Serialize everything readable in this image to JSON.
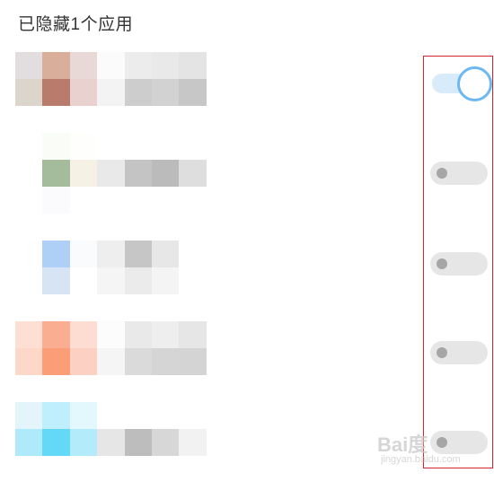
{
  "header": {
    "title": "已隐藏1个应用"
  },
  "apps": [
    {
      "enabled": true,
      "mosaic": [
        [
          "#e2dee0",
          "#d9af9b",
          "#e8d9d6",
          "#fbfbfb",
          "#ececec",
          "#e9e9e9",
          "#e4e4e4"
        ],
        [
          "#dcd5cc",
          "#b97b6b",
          "#e8d1cf",
          "#f3f3f3",
          "#cdcdcd",
          "#d2d2d2",
          "#c7c7c7"
        ],
        [
          "#ffffff",
          "#ffffff",
          "#ffffff",
          "#ffffff",
          "#ffffff",
          "#ffffff",
          "#ffffff"
        ]
      ]
    },
    {
      "enabled": false,
      "mosaic": [
        [
          "#ffffff",
          "#fafcf8",
          "#fefefc",
          "#ffffff",
          "#ffffff",
          "#ffffff",
          "#ffffff"
        ],
        [
          "#ffffff",
          "#a4bb9c",
          "#f5f2e5",
          "#e9e9e9",
          "#c4c4c4",
          "#bbbbbb",
          "#dedede"
        ],
        [
          "#ffffff",
          "#fbfbfd",
          "#ffffff",
          "#ffffff",
          "#ffffff",
          "#ffffff",
          "#ffffff"
        ]
      ]
    },
    {
      "enabled": false,
      "mosaic": [
        [
          "#ffffff",
          "#aed0f6",
          "#fafbfd",
          "#eeeeee",
          "#c6c6c6",
          "#e7e7e7",
          "#ffffff"
        ],
        [
          "#ffffff",
          "#d6e4f4",
          "#ffffff",
          "#f5f5f5",
          "#ebebeb",
          "#f4f4f4",
          "#ffffff"
        ],
        [
          "#ffffff",
          "#ffffff",
          "#ffffff",
          "#ffffff",
          "#ffffff",
          "#ffffff",
          "#ffffff"
        ]
      ]
    },
    {
      "enabled": false,
      "mosaic": [
        [
          "#fde0d3",
          "#fbad91",
          "#fddcd2",
          "#fcfcfc",
          "#e9e9e9",
          "#eeeeee",
          "#e6e6e6"
        ],
        [
          "#fdd7c8",
          "#fb9e78",
          "#fdd0c4",
          "#f5f5f5",
          "#dadada",
          "#d5d5d5",
          "#d4d4d4"
        ],
        [
          "#ffffff",
          "#ffffff",
          "#ffffff",
          "#ffffff",
          "#ffffff",
          "#ffffff",
          "#ffffff"
        ]
      ]
    },
    {
      "enabled": false,
      "mosaic": [
        [
          "#e4f4fb",
          "#bfeffd",
          "#e2f8fd",
          "#ffffff",
          "#ffffff",
          "#ffffff",
          "#ffffff"
        ],
        [
          "#aeeafa",
          "#63d8f7",
          "#b3ebfb",
          "#e6e6e6",
          "#bdbdbd",
          "#d7d7d7",
          "#f2f2f2"
        ],
        [
          "#ffffff",
          "#ffffff",
          "#ffffff",
          "#ffffff",
          "#ffffff",
          "#ffffff",
          "#ffffff"
        ]
      ]
    }
  ],
  "watermark": {
    "brand": "Bai度",
    "site": "jingyan.baidu.com"
  },
  "colors": {
    "toggle_on_track": "#d7ebfa",
    "toggle_on_ring": "#6db8f2",
    "toggle_off_track": "#e6e6e6",
    "toggle_off_knob": "#a6a6a6",
    "highlight_border": "#d4262a"
  }
}
